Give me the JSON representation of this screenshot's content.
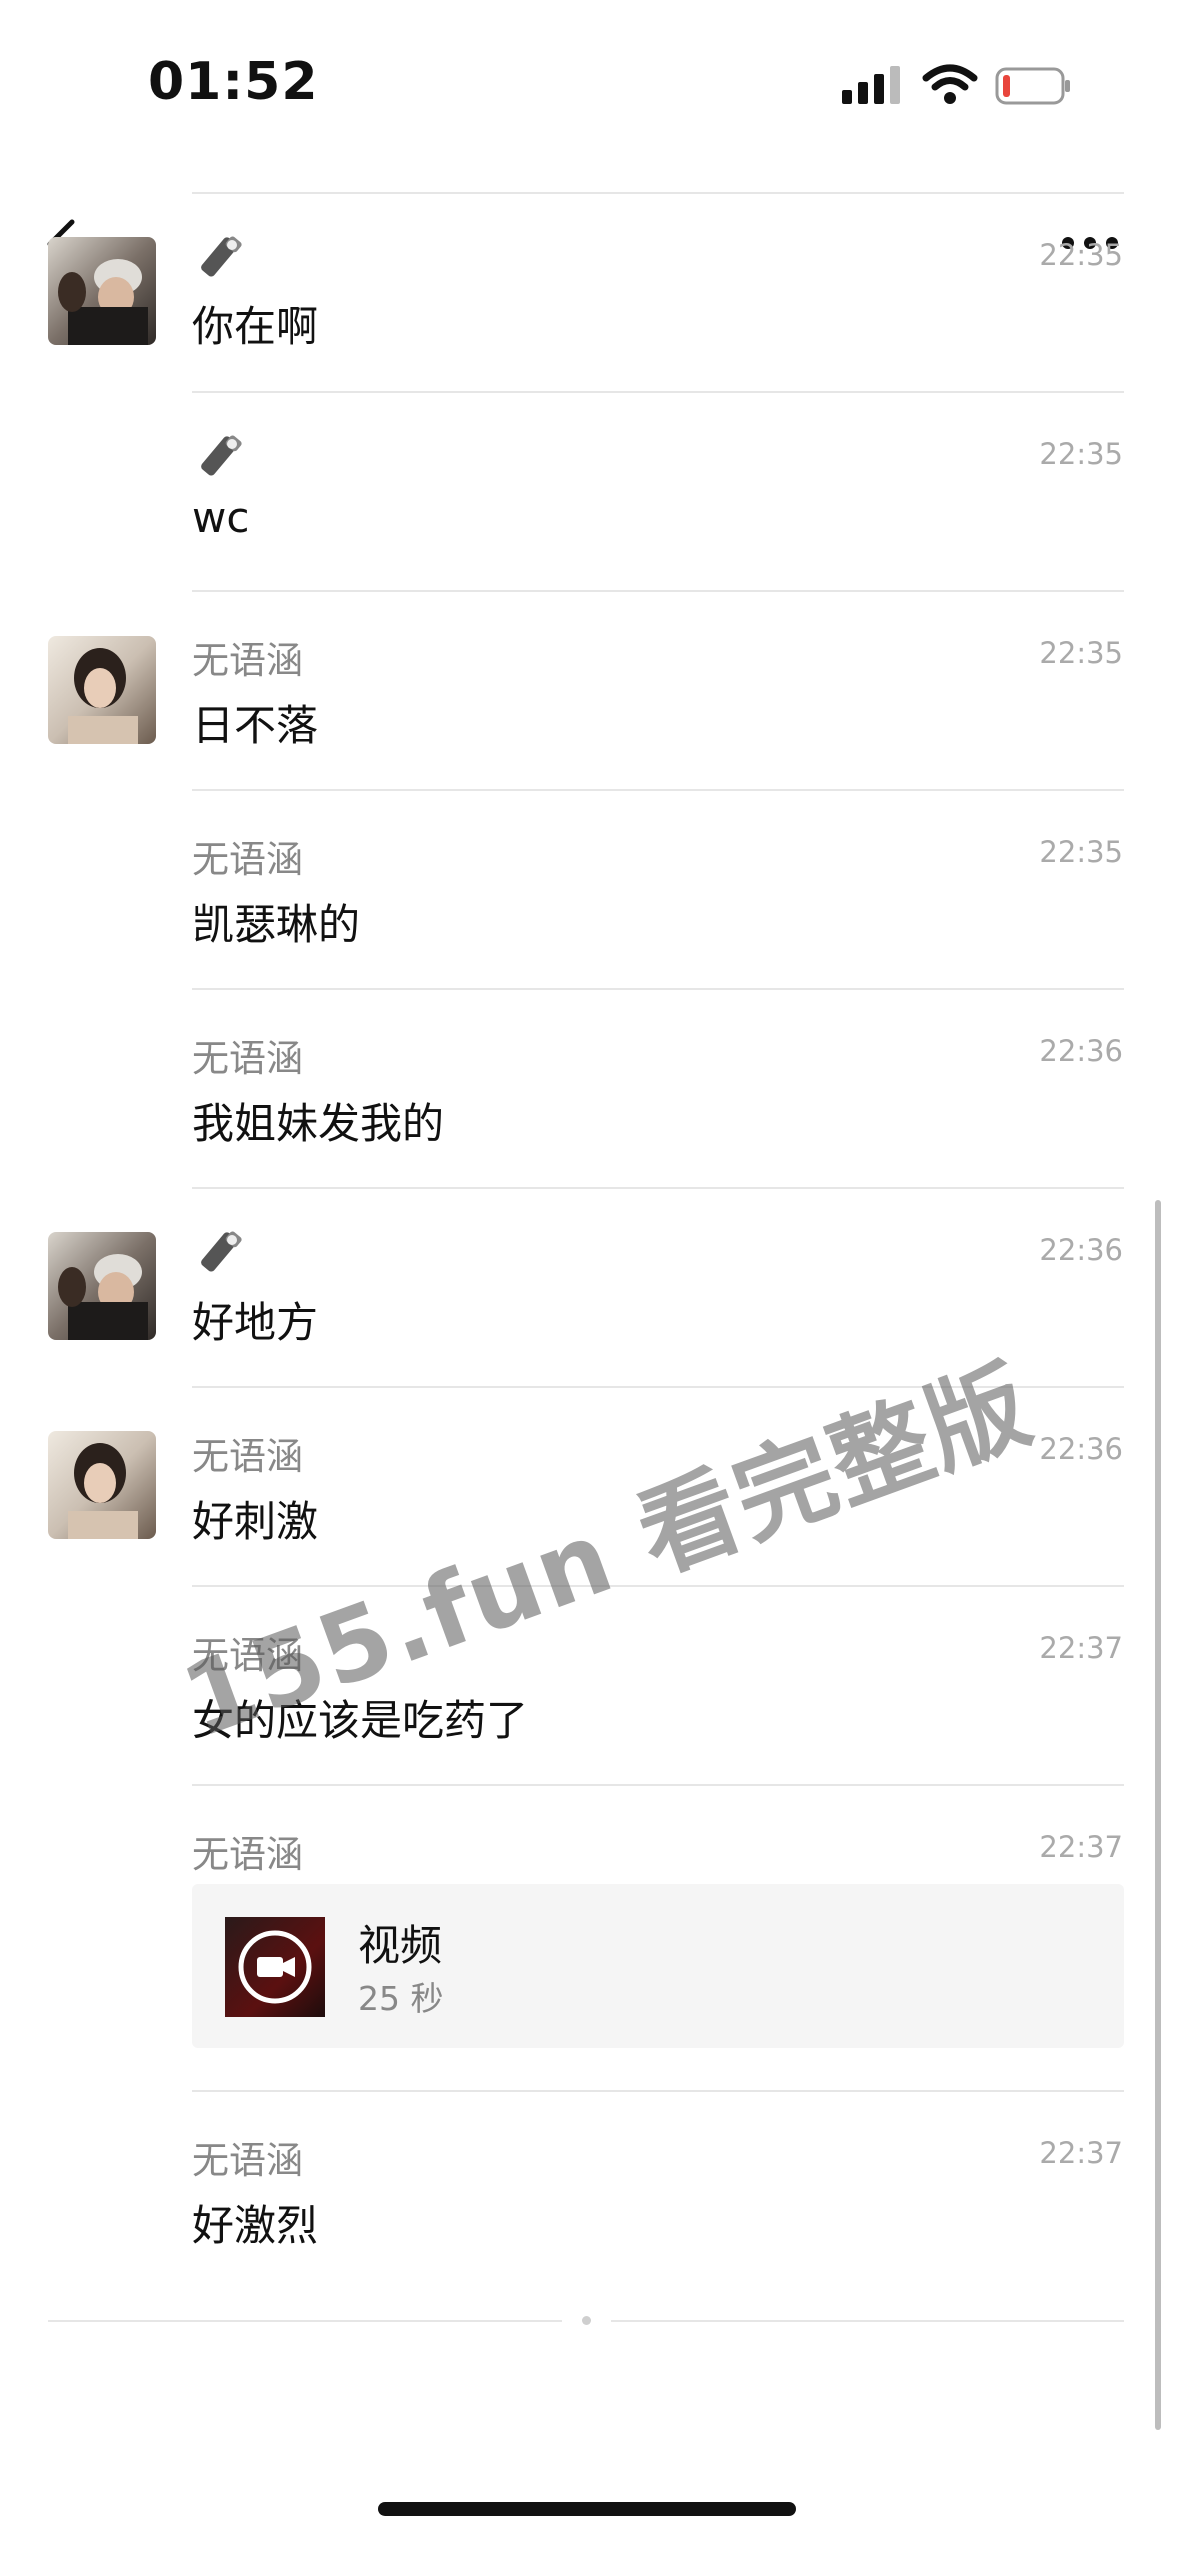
{
  "status_bar": {
    "time": "01:52"
  },
  "messages": [
    {
      "sender": "",
      "sender_is_emoji": true,
      "time": "22:35",
      "text": "你在啊",
      "avatar": "person-a"
    },
    {
      "sender": "",
      "sender_is_emoji": true,
      "time": "22:35",
      "text": "wc",
      "avatar": ""
    },
    {
      "sender": "无语涵",
      "time": "22:35",
      "text": "日不落",
      "avatar": "person-b"
    },
    {
      "sender": "无语涵",
      "time": "22:35",
      "text": "凯瑟琳的",
      "avatar": ""
    },
    {
      "sender": "无语涵",
      "time": "22:36",
      "text": "我姐妹发我的",
      "avatar": ""
    },
    {
      "sender": "",
      "sender_is_emoji": true,
      "time": "22:36",
      "text": "好地方",
      "avatar": "person-a"
    },
    {
      "sender": "无语涵",
      "time": "22:36",
      "text": "好刺激",
      "avatar": "person-b"
    },
    {
      "sender": "无语涵",
      "time": "22:37",
      "text": "女的应该是吃药了",
      "avatar": ""
    },
    {
      "sender": "无语涵",
      "time": "22:37",
      "video": {
        "title": "视频",
        "duration": "25 秒"
      }
    },
    {
      "sender": "无语涵",
      "time": "22:37",
      "text": "好激烈",
      "avatar": ""
    }
  ],
  "watermark": "155.fun 看完整版",
  "icons": {
    "back": "chevron-left-icon",
    "more": "ellipsis-icon",
    "emoji_sender": "flashlight-icon",
    "video": "video-camera-icon"
  },
  "colors": {
    "background": "#ffffff",
    "divider": "#e6e6e6",
    "meta": "#888888",
    "battery_low": "#e8453c"
  }
}
